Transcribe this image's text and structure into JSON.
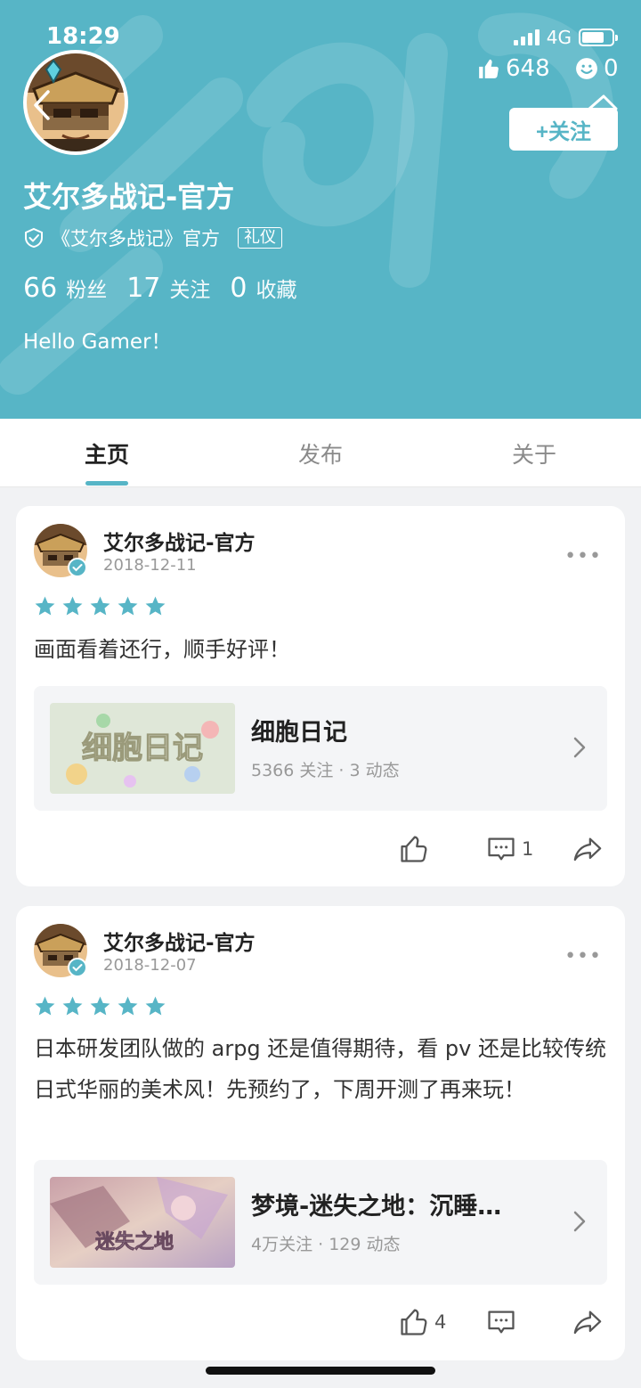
{
  "status_bar": {
    "time": "18:29",
    "network": "4G"
  },
  "profile": {
    "likes": "648",
    "smiles": "0",
    "follow_label": "+关注",
    "name": "艾尔多战记-官方",
    "verification": "《艾尔多战记》官方",
    "tag": "礼仪",
    "fans_count": "66",
    "fans_label": "粉丝",
    "following_count": "17",
    "following_label": "关注",
    "favorites_count": "0",
    "favorites_label": "收藏",
    "bio": "Hello Gamer！"
  },
  "tabs": [
    {
      "label": "主页",
      "active": true
    },
    {
      "label": "发布",
      "active": false
    },
    {
      "label": "关于",
      "active": false
    }
  ],
  "posts": [
    {
      "author": "艾尔多战记-官方",
      "date": "2018-12-11",
      "rating": 5,
      "text": "画面看着还行，顺手好评！",
      "game": {
        "title": "细胞日记",
        "meta": "5366 关注 · 3 动态",
        "thumb_text": "细胞日记"
      },
      "likes": "",
      "comments": "1"
    },
    {
      "author": "艾尔多战记-官方",
      "date": "2018-12-07",
      "rating": 5,
      "text": "日本研发团队做的 arpg 还是值得期待，看 pv 还是比较传统日式华丽的美术风！先预约了，下周开测了再来玩！",
      "game": {
        "title": "梦境-迷失之地：沉睡…",
        "meta": "4万关注 · 129 动态",
        "thumb_text": "迷失之地"
      },
      "likes": "4",
      "comments": ""
    }
  ],
  "colors": {
    "accent": "#57b5c6",
    "star": "#57b5c6",
    "background": "#f1f2f4"
  }
}
